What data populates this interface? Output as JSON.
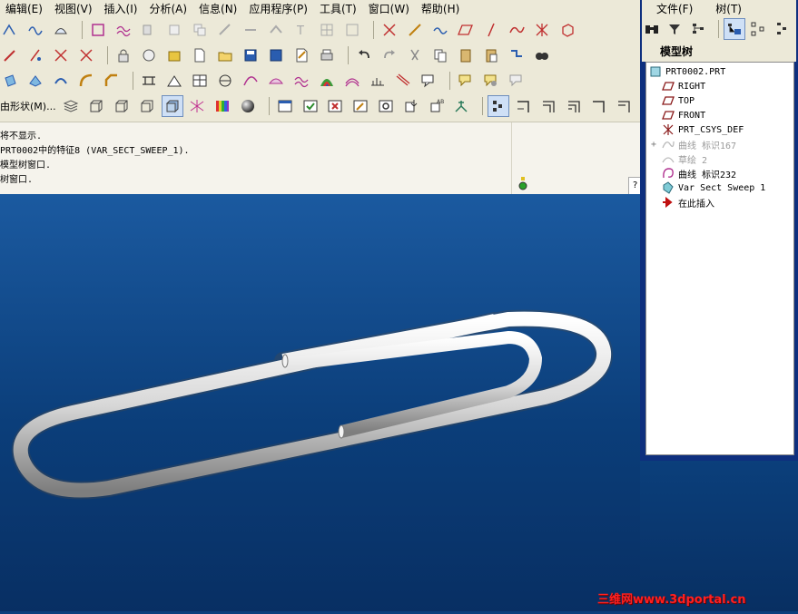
{
  "menu": [
    "编辑(E)",
    "视图(V)",
    "插入(I)",
    "分析(A)",
    "信息(N)",
    "应用程序(P)",
    "工具(T)",
    "窗口(W)",
    "帮助(H)"
  ],
  "toolbar": {
    "shape_label": "由形状(M)...",
    "row1_icons": [
      "box-select-icon",
      "wave-icon",
      "pattern-icon",
      "layers-icon",
      "datum-icon",
      "copy-icon",
      "offset-icon",
      "extend-icon",
      "trim-icon",
      "text-icon",
      "grid-icon",
      "plane-icon",
      "axis-icon",
      "chain-icon",
      "wave-curve-icon",
      "plane-sketch-icon",
      "line-icon",
      "curve-icon",
      "star-icon",
      "cube-icon"
    ],
    "row2_icons": [
      "axis-arrow-icon",
      "line-slash-icon",
      "pen-x-icon",
      "hide-icon",
      "hide2-icon",
      "lock-icon",
      "save-disk-icon",
      "folder-open-icon",
      "new-file-icon",
      "save-icon",
      "save-as-icon",
      "edit-icon",
      "print-icon",
      "undo-icon",
      "redo-icon",
      "cut-icon",
      "copy-file-icon",
      "paste-icon",
      "paste-special-icon",
      "regen-icon",
      "find-icon"
    ],
    "row3_icons": [
      "plane-shade-icon",
      "extrude-icon",
      "shell-icon",
      "round-icon",
      "chamfer-icon",
      "measure-icon",
      "datum-plane-icon",
      "sketch-plane-icon",
      "table-icon",
      "analysis-icon",
      "curvature-icon",
      "color-map-icon",
      "section-icon",
      "offset-ruler-icon",
      "vector-icon",
      "note-icon",
      "tag-icon",
      "layer-icon"
    ],
    "row4_icons": [
      "stack-icon",
      "box-shade-icon",
      "box-wire-icon",
      "box-hidden-icon",
      "box-active-icon",
      "net-icon",
      "spectrum-icon",
      "sphere-icon",
      "window-icon",
      "check-icon",
      "close-window-icon",
      "edit-window-icon",
      "zoom-icon",
      "arrow-point-icon",
      "abc-icon",
      "plant-icon",
      "tree-view-icon",
      "layout-a-icon",
      "layout-b-icon",
      "layout-c-icon",
      "layout-d-icon",
      "layout-e-icon"
    ]
  },
  "messages": [
    "将不显示.",
    "PRT0002中的特征8 (VAR_SECT_SWEEP_1).",
    "模型树窗口.",
    "树窗口."
  ],
  "msg_scroll": "?",
  "right_panel": {
    "menu": [
      "文件(F)",
      "树(T)"
    ],
    "title": "模型树",
    "tree": [
      {
        "label": "PRT0002.PRT",
        "icon": "part-icon",
        "dim": false
      },
      {
        "label": "RIGHT",
        "icon": "datum-plane-icon",
        "dim": false
      },
      {
        "label": "TOP",
        "icon": "datum-plane-icon",
        "dim": false
      },
      {
        "label": "FRONT",
        "icon": "datum-plane-icon",
        "dim": false
      },
      {
        "label": "PRT_CSYS_DEF",
        "icon": "csys-icon",
        "dim": false
      },
      {
        "label": "曲线 标识167",
        "icon": "curve-icon",
        "dim": true
      },
      {
        "label": "草绘 2",
        "icon": "sketch-icon",
        "dim": true
      },
      {
        "label": "曲线 标识232",
        "icon": "curve-icon",
        "dim": false
      },
      {
        "label": "Var Sect Sweep 1",
        "icon": "sweep-icon",
        "dim": false
      },
      {
        "label": "在此插入",
        "icon": "insert-arrow-icon",
        "dim": false
      }
    ]
  },
  "watermark": "三维网www.3dportal.cn"
}
